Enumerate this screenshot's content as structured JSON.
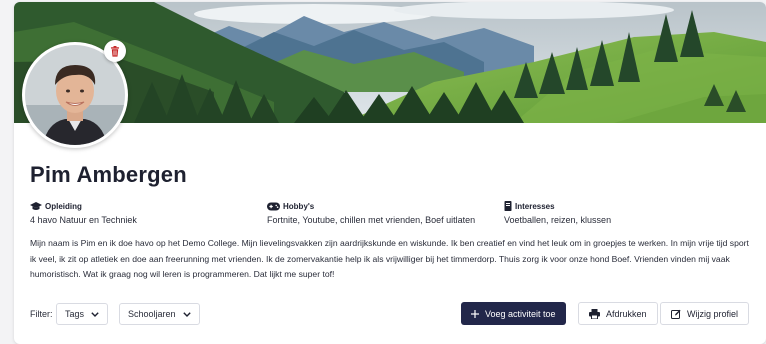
{
  "colors": {
    "primary": "#22274a",
    "delete": "#c62828",
    "text": "#1e2130"
  },
  "profile": {
    "name": "Pim Ambergen",
    "delete_photo_icon": "trash-icon"
  },
  "info": {
    "education": {
      "label": "Opleiding",
      "value": "4 havo Natuur en Techniek",
      "icon": "graduation-cap-icon"
    },
    "hobbies": {
      "label": "Hobby's",
      "value": "Fortnite, Youtube, chillen met vrienden, Boef uitlaten",
      "icon": "gamepad-icon"
    },
    "interests": {
      "label": "Interesses",
      "value": "Voetballen, reizen, klussen",
      "icon": "book-icon"
    }
  },
  "bio": "Mijn naam is Pim en ik doe havo op het Demo College. Mijn lievelingsvakken zijn aardrijkskunde en wiskunde. Ik ben creatief en vind het leuk om in groepjes te werken. In mijn vrije tijd sport ik veel, ik zit op atletiek en doe aan freerunning met vrienden. Ik de zomervakantie help ik als vrijwilliger bij het timmerdorp. Thuis zorg ik voor onze hond Boef. Vrienden vinden mij vaak humoristisch. Wat ik graag nog wil leren is programmeren. Dat lijkt me super tof!",
  "toolbar": {
    "filter_label": "Filter:",
    "tags_label": "Tags",
    "schoolyears_label": "Schooljaren",
    "add_activity_label": "Voeg activiteit toe",
    "print_label": "Afdrukken",
    "edit_profile_label": "Wijzig profiel"
  }
}
